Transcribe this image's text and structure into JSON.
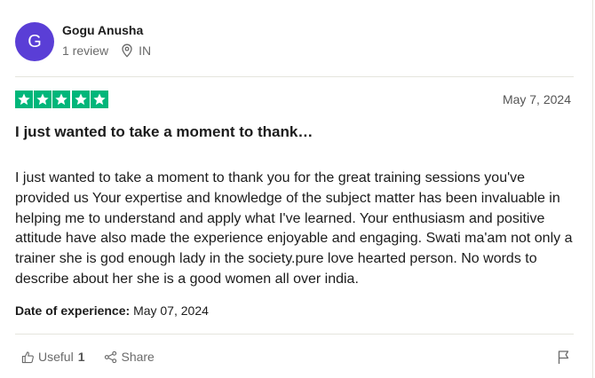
{
  "reviewer": {
    "initial": "G",
    "avatar_color": "#5a3ed6",
    "name": "Gogu Anusha",
    "review_count": "1 review",
    "location": "IN",
    "location_icon": "map-pin-icon"
  },
  "review": {
    "rating": 5,
    "max_rating": 5,
    "star_color": "#00b67a",
    "date": "May 7, 2024",
    "title": "I just wanted to take a moment to thank…",
    "body": "I just wanted to take a moment to thank you for the great training sessions you've provided us Your expertise and knowledge of the subject matter has been invaluable in helping me to understand and apply what I've learned. Your enthusiasm and positive attitude have also made the experience enjoyable and engaging. Swati ma'am not only a trainer she is god enough lady in the society.pure love hearted person. No words to describe about her she is a good women all over india.",
    "experience_label": "Date of experience:",
    "experience_date": "May 07, 2024"
  },
  "actions": {
    "useful_label": "Useful",
    "useful_count": "1",
    "useful_icon": "thumbs-up-icon",
    "share_label": "Share",
    "share_icon": "share-icon",
    "report_icon": "flag-icon"
  }
}
